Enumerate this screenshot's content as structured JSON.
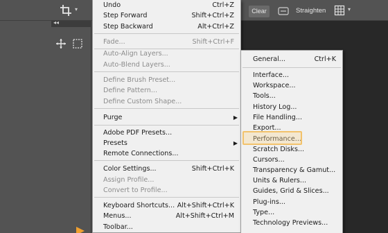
{
  "options_bar": {
    "clear_label": "Clear",
    "straighten_label": "Straighten"
  },
  "tool_panel": {
    "collapse_glyph": "◂◂"
  },
  "icons": {
    "crop": "crop-icon",
    "move": "move-icon",
    "marquee": "marquee-icon",
    "straighten": "straighten-icon",
    "grid": "grid-icon"
  },
  "colors": {
    "highlight_border": "#f2c26b",
    "arrow": "#f0a030"
  },
  "edit_menu": {
    "items": [
      {
        "label": "Undo",
        "shortcut": "Ctrl+Z",
        "enabled": true
      },
      {
        "label": "Step Forward",
        "shortcut": "Shift+Ctrl+Z",
        "enabled": true
      },
      {
        "label": "Step Backward",
        "shortcut": "Alt+Ctrl+Z",
        "enabled": true
      },
      {
        "label": "Fade...",
        "shortcut": "Shift+Ctrl+F",
        "enabled": false
      },
      {
        "label": "Auto-Align Layers...",
        "shortcut": "",
        "enabled": false
      },
      {
        "label": "Auto-Blend Layers...",
        "shortcut": "",
        "enabled": false
      },
      {
        "label": "Define Brush Preset...",
        "shortcut": "",
        "enabled": false
      },
      {
        "label": "Define Pattern...",
        "shortcut": "",
        "enabled": false
      },
      {
        "label": "Define Custom Shape...",
        "shortcut": "",
        "enabled": false
      },
      {
        "label": "Purge",
        "shortcut": "",
        "enabled": true,
        "submenu": true
      },
      {
        "label": "Adobe PDF Presets...",
        "shortcut": "",
        "enabled": true
      },
      {
        "label": "Presets",
        "shortcut": "",
        "enabled": true,
        "submenu": true
      },
      {
        "label": "Remote Connections...",
        "shortcut": "",
        "enabled": true
      },
      {
        "label": "Color Settings...",
        "shortcut": "Shift+Ctrl+K",
        "enabled": true
      },
      {
        "label": "Assign Profile...",
        "shortcut": "",
        "enabled": false
      },
      {
        "label": "Convert to Profile...",
        "shortcut": "",
        "enabled": false
      },
      {
        "label": "Keyboard Shortcuts...",
        "shortcut": "Alt+Shift+Ctrl+K",
        "enabled": true
      },
      {
        "label": "Menus...",
        "shortcut": "Alt+Shift+Ctrl+M",
        "enabled": true
      },
      {
        "label": "Toolbar...",
        "shortcut": "",
        "enabled": true
      }
    ]
  },
  "preferences_menu": {
    "items": [
      {
        "label": "General...",
        "shortcut": "Ctrl+K"
      },
      {
        "label": "Interface...",
        "shortcut": ""
      },
      {
        "label": "Workspace...",
        "shortcut": ""
      },
      {
        "label": "Tools...",
        "shortcut": ""
      },
      {
        "label": "History Log...",
        "shortcut": ""
      },
      {
        "label": "File Handling...",
        "shortcut": ""
      },
      {
        "label": "Export...",
        "shortcut": ""
      },
      {
        "label": "Performance...",
        "shortcut": "",
        "highlighted": true
      },
      {
        "label": "Scratch Disks...",
        "shortcut": ""
      },
      {
        "label": "Cursors...",
        "shortcut": ""
      },
      {
        "label": "Transparency & Gamut...",
        "shortcut": ""
      },
      {
        "label": "Units & Rulers...",
        "shortcut": ""
      },
      {
        "label": "Guides, Grid & Slices...",
        "shortcut": ""
      },
      {
        "label": "Plug-ins...",
        "shortcut": ""
      },
      {
        "label": "Type...",
        "shortcut": ""
      },
      {
        "label": "Technology Previews...",
        "shortcut": ""
      }
    ]
  }
}
